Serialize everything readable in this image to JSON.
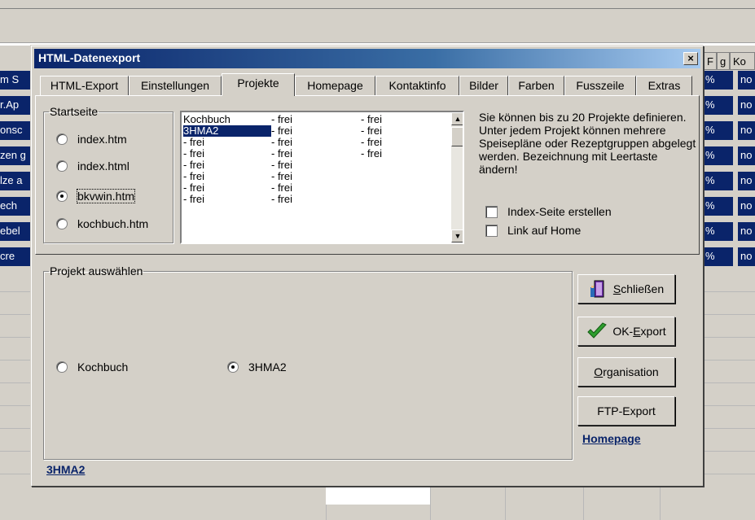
{
  "background": {
    "header_cells": [
      "F",
      "g",
      "Ko"
    ],
    "left_cells": [
      "m S",
      "r.Ap",
      "onsc",
      "zen g",
      "lze a",
      "ech",
      "ebel",
      " cre"
    ],
    "right_cells": [
      "no",
      "no",
      "no",
      "no",
      "no",
      "no",
      "no",
      "no"
    ],
    "percent": "%"
  },
  "dialog": {
    "title": "HTML-Datenexport",
    "close_label": "×",
    "tabs": [
      "HTML-Export",
      "Einstellungen",
      "Projekte",
      "Homepage",
      "Kontaktinfo",
      "Bilder",
      "Farben",
      "Fusszeile",
      "Extras"
    ],
    "active_tab": "Projekte",
    "startseite": {
      "legend": "Startseite",
      "options": [
        "index.htm",
        "index.html",
        "bkvwin.htm",
        "kochbuch.htm"
      ],
      "selected": "bkvwin.htm"
    },
    "project_list": {
      "rows": [
        [
          "Kochbuch",
          "- frei",
          "- frei"
        ],
        [
          "3HMA2",
          "- frei",
          "- frei"
        ],
        [
          "- frei",
          "- frei",
          "- frei"
        ],
        [
          "- frei",
          "- frei",
          "- frei"
        ],
        [
          "- frei",
          "- frei",
          ""
        ],
        [
          "- frei",
          "- frei",
          ""
        ],
        [
          "- frei",
          "- frei",
          ""
        ],
        [
          "- frei",
          "- frei",
          ""
        ]
      ],
      "selected_row": "3HMA2"
    },
    "info_text": "Sie können bis zu 20 Projekte definieren. Unter jedem Projekt können mehrere Speisepläne oder Rezeptgruppen abgelegt werden. Bezeichnung mit Leertaste ändern!",
    "checkbox_index": "Index-Seite erstellen",
    "checkbox_home": "Link auf Home",
    "projekt_auswaehlen": {
      "legend": "Projekt auswählen",
      "options": [
        "Kochbuch",
        "3HMA2"
      ],
      "selected": "3HMA2"
    },
    "buttons": {
      "close": {
        "underlined": "S",
        "rest": "chließen"
      },
      "ok_export": {
        "prefix": "OK-",
        "underlined": "E",
        "rest": "xport"
      },
      "organisation": {
        "underlined": "O",
        "rest": "rganisation"
      },
      "ftp_export": "FTP-Export"
    },
    "homepage_link": "Homepage",
    "status_project": "3HMA2",
    "colors": {
      "titlebar": "#0a246a",
      "selection": "#0a246a",
      "link": "#0a246a",
      "dialog_bg": "#d4d0c8"
    },
    "icons": [
      "door-exit-icon",
      "checkmark-icon"
    ]
  }
}
